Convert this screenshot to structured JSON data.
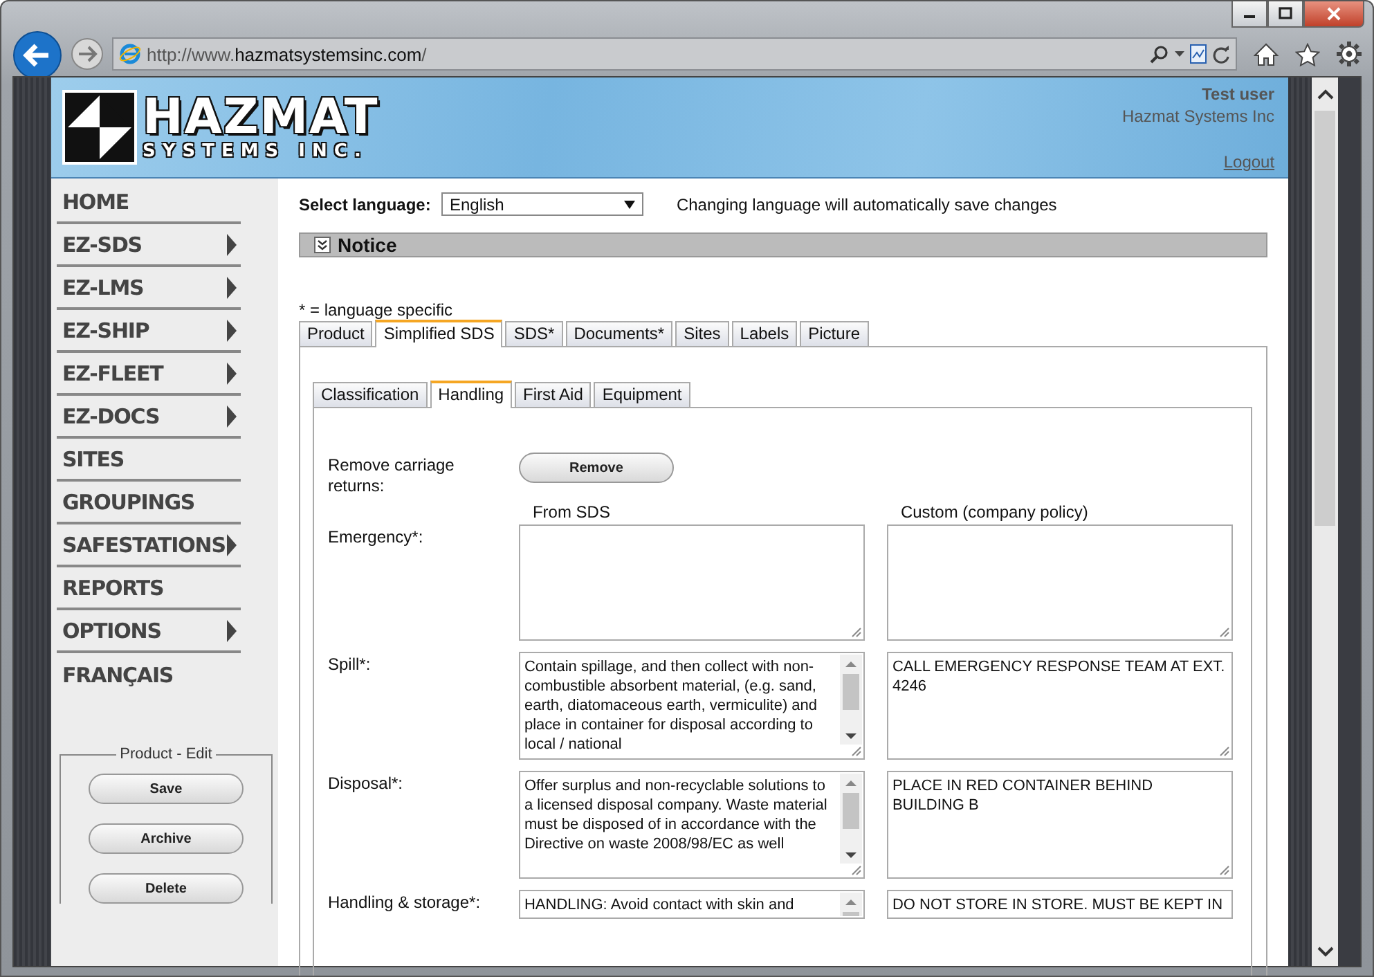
{
  "browser": {
    "url": "http://www.**hazmatsystemsinc.com**/"
  },
  "header": {
    "logo_title": "HAZMAT",
    "logo_subtitle": "SYSTEMS INC.",
    "user": "Test user",
    "company": "Hazmat Systems Inc",
    "logout": "Logout"
  },
  "nav": [
    {
      "label": "HOME",
      "has_submenu": false
    },
    {
      "label": "EZ-SDS",
      "has_submenu": true
    },
    {
      "label": "EZ-LMS",
      "has_submenu": true
    },
    {
      "label": "EZ-SHIP",
      "has_submenu": true
    },
    {
      "label": "EZ-FLEET",
      "has_submenu": true
    },
    {
      "label": "EZ-DOCS",
      "has_submenu": true
    },
    {
      "label": "SITES",
      "has_submenu": false
    },
    {
      "label": "GROUPINGS",
      "has_submenu": false
    },
    {
      "label": "SAFESTATIONS",
      "has_submenu": true
    },
    {
      "label": "REPORTS",
      "has_submenu": false
    },
    {
      "label": "OPTIONS",
      "has_submenu": true
    },
    {
      "label": "FRANÇAIS",
      "has_submenu": false
    }
  ],
  "edit_panel": {
    "legend": "Product - Edit",
    "buttons": [
      "Save",
      "Archive",
      "Delete"
    ]
  },
  "language": {
    "label": "Select language:",
    "value": "English",
    "note": "Changing language will automatically save changes"
  },
  "notice": {
    "title": "Notice",
    "expanded": false
  },
  "legend_note": "* = language specific",
  "tabs": [
    {
      "label": "Product",
      "selected": false
    },
    {
      "label": "Simplified SDS",
      "selected": true
    },
    {
      "label": "SDS*",
      "selected": false
    },
    {
      "label": "Documents*",
      "selected": false
    },
    {
      "label": "Sites",
      "selected": false
    },
    {
      "label": "Labels",
      "selected": false
    },
    {
      "label": "Picture",
      "selected": false
    }
  ],
  "subtabs": [
    {
      "label": "Classification",
      "selected": false
    },
    {
      "label": "Handling",
      "selected": true
    },
    {
      "label": "First Aid",
      "selected": false
    },
    {
      "label": "Equipment",
      "selected": false
    }
  ],
  "remove": {
    "label": "Remove carriage returns:",
    "button": "Remove"
  },
  "columns": [
    "From SDS",
    "Custom (company policy)"
  ],
  "fields": [
    {
      "label": "Emergency*:"
    },
    {
      "label": "Spill*:",
      "from_sds": "Contain spillage, and then collect with non-combustible absorbent material, (e.g. sand, earth, diatomaceous earth, vermiculite) and place in container for disposal according to local / national",
      "custom": "CALL EMERGENCY RESPONSE TEAM AT EXT. 4246"
    },
    {
      "label": "Disposal*:",
      "from_sds": "Offer surplus and non-recyclable solutions to a licensed disposal company. Waste material must be disposed of in accordance with the Directive on waste 2008/98/EC as well",
      "custom": "PLACE IN RED CONTAINER BEHIND BUILDING B"
    },
    {
      "label": "Handling & storage*:",
      "from_sds": "HANDLING: Avoid contact with skin and",
      "custom": "DO NOT STORE IN STORE. MUST BE KEPT IN"
    }
  ]
}
